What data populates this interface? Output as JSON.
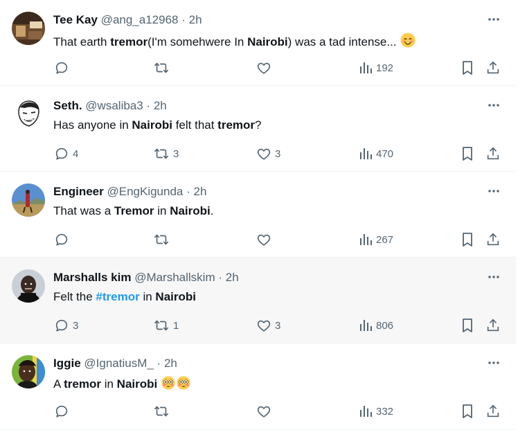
{
  "colors": {
    "icon": "#536471",
    "text": "#0f1419",
    "hashtag": "#1d9bf0",
    "border": "#eff3f4",
    "highlight_bg": "#f7f7f7"
  },
  "tweets": [
    {
      "name": "Tee Kay",
      "handle": "@ang_a12968",
      "time": "2h",
      "text_parts": [
        {
          "t": "That earth "
        },
        {
          "t": "tremor",
          "bold": true
        },
        {
          "t": "(I'm somehwere In "
        },
        {
          "t": "Nairobi",
          "bold": true
        },
        {
          "t": ") was a tad intense... "
        },
        {
          "emoji": "smiling-face"
        }
      ],
      "replies": "",
      "retweets": "",
      "likes": "",
      "views": "192",
      "avatar": "room-photo"
    },
    {
      "name": "Seth.",
      "handle": "@wsaliba3",
      "time": "2h",
      "text_parts": [
        {
          "t": "Has anyone in "
        },
        {
          "t": "Nairobi",
          "bold": true
        },
        {
          "t": " felt that "
        },
        {
          "t": "tremor",
          "bold": true
        },
        {
          "t": "?"
        }
      ],
      "replies": "4",
      "retweets": "3",
      "likes": "3",
      "views": "470",
      "avatar": "meme-face"
    },
    {
      "name": "Engineer",
      "handle": "@EngKigunda",
      "time": "2h",
      "text_parts": [
        {
          "t": "That was a "
        },
        {
          "t": "Tremor",
          "bold": true
        },
        {
          "t": " in "
        },
        {
          "t": "Nairobi",
          "bold": true
        },
        {
          "t": "."
        }
      ],
      "replies": "",
      "retweets": "",
      "likes": "",
      "views": "267",
      "avatar": "landscape"
    },
    {
      "name": "Marshalls kim",
      "handle": "@Marshallskim",
      "time": "2h",
      "text_parts": [
        {
          "t": "Felt the "
        },
        {
          "t": "#tremor",
          "hashtag": true
        },
        {
          "t": " in "
        },
        {
          "t": "Nairobi",
          "bold": true
        }
      ],
      "replies": "3",
      "retweets": "1",
      "likes": "3",
      "views": "806",
      "avatar": "portrait-dark"
    },
    {
      "name": "Iggie",
      "handle": "@IgnatiusM_",
      "time": "2h",
      "text_parts": [
        {
          "t": "A "
        },
        {
          "t": "tremor",
          "bold": true
        },
        {
          "t": " in "
        },
        {
          "t": "Nairobi",
          "bold": true
        },
        {
          "t": " "
        },
        {
          "emoji": "flushed-face"
        },
        {
          "emoji": "flushed-face"
        }
      ],
      "replies": "",
      "retweets": "",
      "likes": "",
      "views": "332",
      "avatar": "portrait-green"
    }
  ]
}
